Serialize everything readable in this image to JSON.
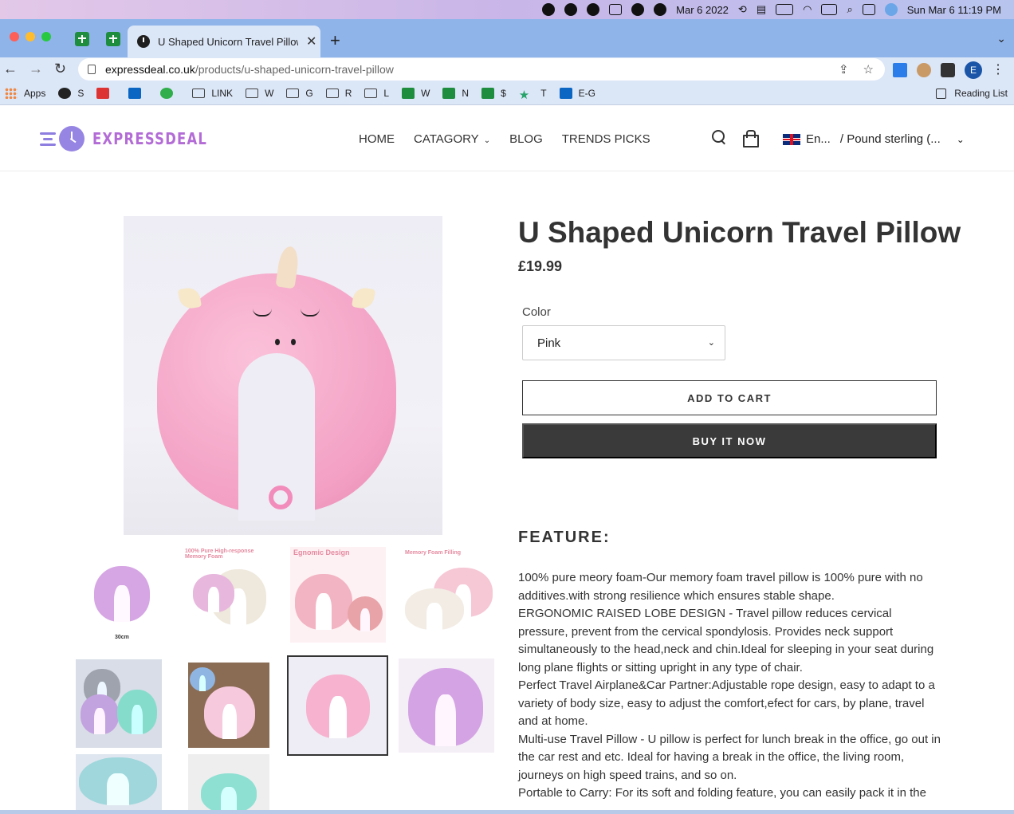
{
  "menubar": {
    "date_short": "Mar 6 2022",
    "clock": "Sun Mar 6  11:19 PM"
  },
  "browser": {
    "tab_title": "U Shaped Unicorn Travel Pillow",
    "tab_close": "✕",
    "new_tab": "+",
    "url_domain": "expressdeal.co.uk",
    "url_path": "/products/u-shaped-unicorn-travel-pillow",
    "avatar_letter": "E",
    "reading_list": "Reading List"
  },
  "bookmarks": [
    {
      "label": "Apps",
      "icon": "grid"
    },
    {
      "label": "S",
      "icon": "globe"
    },
    {
      "label": "",
      "icon": "red"
    },
    {
      "label": "",
      "icon": "blue"
    },
    {
      "label": "",
      "icon": "gdot"
    },
    {
      "label": "LINK",
      "icon": "folder"
    },
    {
      "label": "W",
      "icon": "folder"
    },
    {
      "label": "G",
      "icon": "folder"
    },
    {
      "label": "R",
      "icon": "folder"
    },
    {
      "label": "L",
      "icon": "folder"
    },
    {
      "label": "W",
      "icon": "green"
    },
    {
      "label": "N",
      "icon": "green"
    },
    {
      "label": "$",
      "icon": "green"
    },
    {
      "label": "T",
      "icon": "star"
    },
    {
      "label": "E-G",
      "icon": "blue"
    }
  ],
  "site": {
    "logo_text": "EXPRESSDEAL",
    "nav": {
      "home": "HOME",
      "category": "CATAGORY",
      "blog": "BLOG",
      "trends": "TRENDS PICKS"
    },
    "language": "En...",
    "currency": "/ Pound sterling (..."
  },
  "product": {
    "title": "U Shaped Unicorn Travel Pillow",
    "price": "£19.99",
    "color_label": "Color",
    "color_value": "Pink",
    "add_to_cart": "ADD TO CART",
    "buy_now": "BUY IT NOW",
    "feature_heading": "FEATURE:",
    "description": [
      "100% pure meory foam-Our memory foam travel pillow is 100% pure with no additives.with strong resilience which ensures stable shape.",
      "ERGONOMIC RAISED LOBE DESIGN - Travel pillow reduces cervical pressure, prevent from the cervical spondylosis. Provides neck support simultaneously to the head,neck and chin.Ideal for sleeping in your seat during long plane flights or sitting upright in any type of chair.",
      "Perfect Travel Airplane&Car Partner:Adjustable rope design, easy to adapt to a variety of body size, easy to adjust the comfort,efect for cars, by plane, travel and at home.",
      "Multi-use Travel Pillow - U pillow is perfect for lunch break in the office, go out in the car rest and etc. Ideal for having a break in the office, the living room, journeys on high speed trains, and so on.",
      "Portable to Carry: For its soft and folding feature, you can easily pack it in the"
    ]
  },
  "thumbnails": {
    "t1_text": "30cm",
    "t2_text": "100% Pure High-response Memory Foam",
    "t3_text": "Egnomic Design",
    "t4_text": "Memory Foam Filling"
  }
}
